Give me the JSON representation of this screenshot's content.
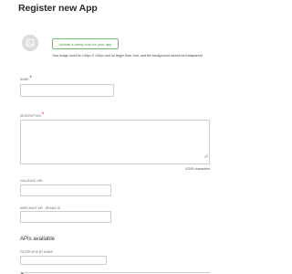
{
  "header": {
    "title": "Register new App"
  },
  "logo": {
    "icon": "image-placeholder-icon"
  },
  "upload": {
    "button_label": "Upload a pretty icon for your app",
    "hint": "Your image must be 140px X 140px and no larger than 1mb, and the background cannot be transparent"
  },
  "form": {
    "name": {
      "label": "NAME",
      "required_mark": "*",
      "value": ""
    },
    "description": {
      "label": "DESCRIPTION",
      "required_mark": "*",
      "value": "",
      "char_count": "0/200 characters"
    },
    "callback_url": {
      "label": "CALLBACK URL",
      "value": ""
    },
    "merchant_id": {
      "label": "MERCHANT API - BRAND ID",
      "value": ""
    }
  },
  "apis": {
    "section_title": "APIs available",
    "filter_label": "FILTER APIS BY NAME",
    "filter_value": "",
    "search_icon": "magnifier-icon"
  },
  "colors": {
    "accent_green": "#6cc26c",
    "required_red": "#d0021b",
    "border_gray": "#cccccc"
  }
}
